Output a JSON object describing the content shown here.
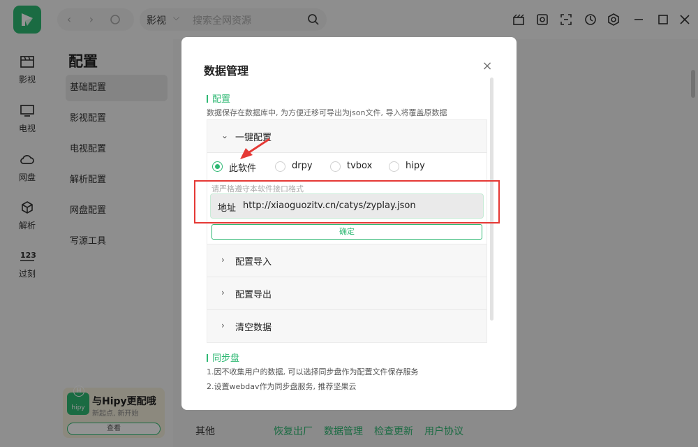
{
  "app": {
    "search_category": "影视",
    "search_placeholder": "搜索全网资源"
  },
  "sidebar": {
    "items": [
      {
        "label": "影视"
      },
      {
        "label": "电视"
      },
      {
        "label": "网盘"
      },
      {
        "label": "解析"
      },
      {
        "label": "过刻"
      }
    ]
  },
  "subnav": {
    "title": "配置",
    "items": [
      {
        "label": "基础配置"
      },
      {
        "label": "影视配置"
      },
      {
        "label": "电视配置"
      },
      {
        "label": "解析配置"
      },
      {
        "label": "网盘配置"
      },
      {
        "label": "写源工具"
      }
    ]
  },
  "promo": {
    "icon_text": "hipy",
    "title": "与Hipy更配哦",
    "subtitle": "新起点, 新开始",
    "button": "查看"
  },
  "footer": {
    "label": "其他",
    "links": [
      "恢复出厂",
      "数据管理",
      "检查更新",
      "用户协议"
    ]
  },
  "modal": {
    "title": "数据管理",
    "close": "×",
    "config_section": {
      "title": "配置",
      "desc": "数据保存在数据库中, 为方便迁移可导出为json文件, 导入将覆盖原数据",
      "one_click": {
        "label": "一键配置",
        "radios": [
          {
            "label": "此软件",
            "checked": true
          },
          {
            "label": "drpy",
            "checked": false
          },
          {
            "label": "tvbox",
            "checked": false
          },
          {
            "label": "hipy",
            "checked": false
          }
        ],
        "hint": "请严格遵守本软件接口格式",
        "address_label": "地址",
        "address_value": "http://xiaoguozitv.cn/catys/zyplay.json",
        "confirm": "确定"
      },
      "collapsed": [
        {
          "label": "配置导入"
        },
        {
          "label": "配置导出"
        },
        {
          "label": "清空数据"
        }
      ]
    },
    "sync_section": {
      "title": "同步盘",
      "lines": [
        "1.因不收集用户的数据, 可以选择同步盘作为配置文件保存服务",
        "2.设置webdav作为同步盘服务, 推荐坚果云"
      ]
    }
  },
  "colors": {
    "accent": "#2eb873",
    "annotation": "#e53935"
  }
}
